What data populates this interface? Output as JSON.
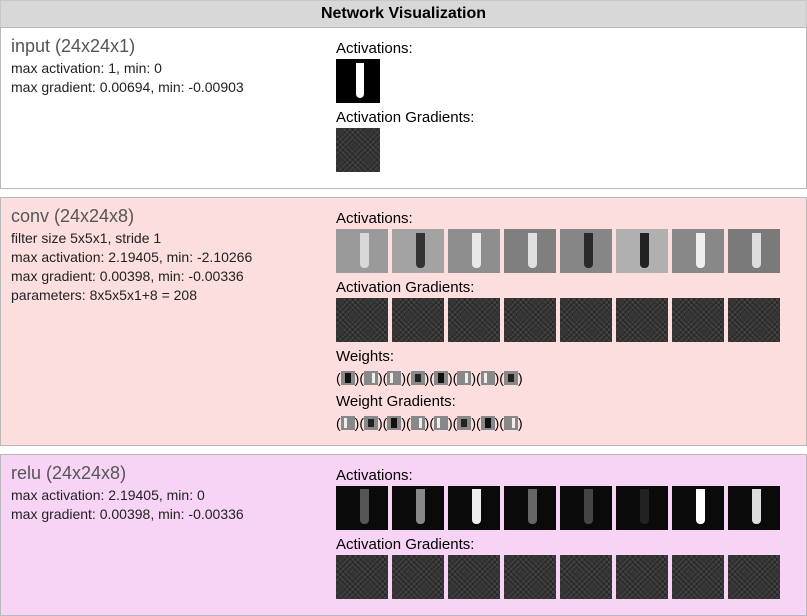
{
  "title": "Network Visualization",
  "colors": {
    "title_bg": "#d8d8d8",
    "input_bg": "#ffffff",
    "conv_bg": "#fcdede",
    "relu_bg": "#f7d4f5",
    "border": "#b8b8b8"
  },
  "labels": {
    "activations": "Activations:",
    "act_grads": "Activation Gradients:",
    "weights": "Weights:",
    "weight_grads": "Weight Gradients:"
  },
  "layers": {
    "input": {
      "name": "input (24x24x1)",
      "max_act": "max activation: 1, min: 0",
      "max_grad": "max gradient: 0.00694, min: -0.00903",
      "activation_count": 1,
      "gradient_count": 1
    },
    "conv": {
      "name": "conv (24x24x8)",
      "filter": "filter size 5x5x1, stride 1",
      "max_act": "max activation: 2.19405, min: -2.10266",
      "max_grad": "max gradient: 0.00398, min: -0.00336",
      "params": "parameters: 8x5x5x1+8 = 208",
      "activation_count": 8,
      "gradient_count": 8,
      "weight_count": 8,
      "weight_grad_count": 8
    },
    "relu": {
      "name": "relu (24x24x8)",
      "max_act": "max activation: 2.19405, min: 0",
      "max_grad": "max gradient: 0.00398, min: -0.00336",
      "activation_count": 8,
      "gradient_count": 8
    }
  }
}
